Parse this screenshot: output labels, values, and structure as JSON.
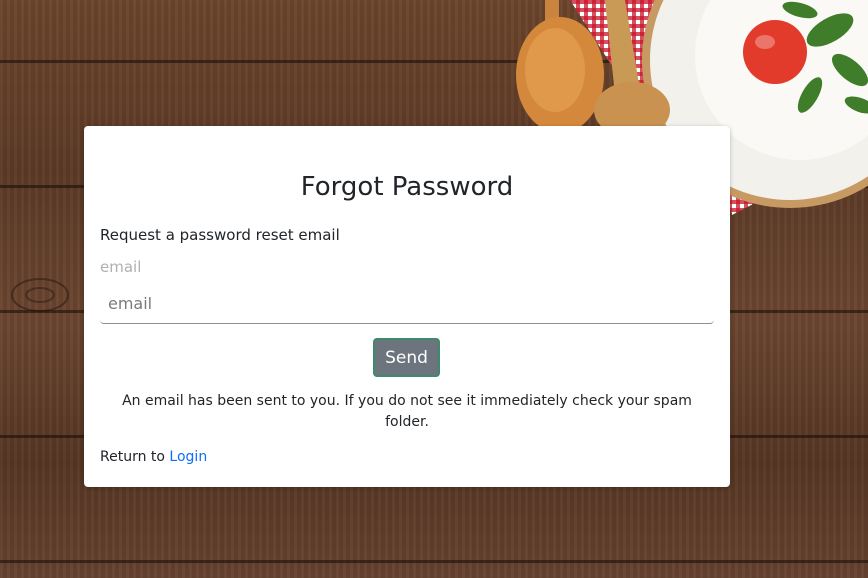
{
  "form": {
    "title": "Forgot Password",
    "subtitle": "Request a password reset email",
    "email_label": "email",
    "email_placeholder": "email",
    "email_value": "",
    "send_label": "Send",
    "message": "An email has been sent to you. If you do not see it immediately check your spam folder.",
    "return_text": "Return to",
    "login_link": "Login"
  },
  "colors": {
    "button_bg": "#6c757d",
    "button_border": "#3f8a6a",
    "link": "#0d6efd",
    "label_muted": "#b0b0b0"
  }
}
